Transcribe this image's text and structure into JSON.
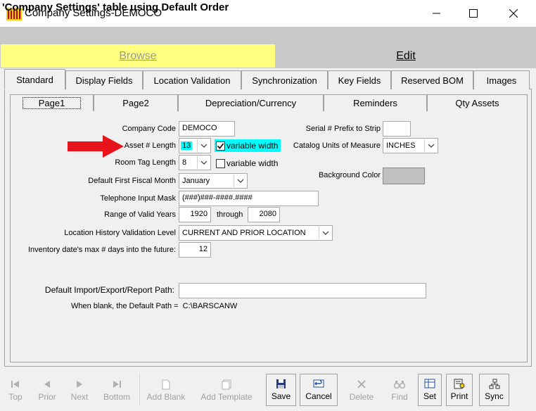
{
  "window": {
    "title": "Company Settings-DEMOCO",
    "header": "'Company Settings' table using Default Order"
  },
  "mode_tabs": {
    "browse": "Browse",
    "edit": "Edit"
  },
  "tabs": [
    "Standard",
    "Display Fields",
    "Location Validation",
    "Synchronization",
    "Key Fields",
    "Reserved BOM",
    "Images"
  ],
  "subtabs": [
    "Page1",
    "Page2",
    "Depreciation/Currency",
    "Reminders",
    "Qty Assets"
  ],
  "form": {
    "company_code": {
      "label": "Company Code",
      "value": "DEMOCO"
    },
    "asset_length": {
      "label": "Asset # Length",
      "value": "13",
      "checkbox_label": "variable width",
      "checked": true
    },
    "room_tag_length": {
      "label": "Room Tag Length",
      "value": "8",
      "checkbox_label": "variable width",
      "checked": false
    },
    "fiscal_month": {
      "label": "Default First Fiscal Month",
      "value": "January"
    },
    "phone_mask": {
      "label": "Telephone Input Mask",
      "value": "(###)###-####.####"
    },
    "valid_years": {
      "label": "Range of Valid Years",
      "from": "1920",
      "through_label": "through",
      "to": "2080"
    },
    "location_history": {
      "label": "Location History Validation Level",
      "value": "CURRENT AND PRIOR LOCATION"
    },
    "inventory_days": {
      "label": "Inventory date's max # days into the future:",
      "value": "12"
    },
    "serial_prefix": {
      "label": "Serial # Prefix to Strip",
      "value": ""
    },
    "catalog_units": {
      "label": "Catalog Units of Measure",
      "value": "INCHES"
    },
    "background_color": {
      "label": "Background Color",
      "value": "#c0c0c0"
    },
    "default_path": {
      "label": "Default Import/Export/Report Path:",
      "value": "",
      "note": "When blank, the Default Path =  C:\\BARSCANW"
    }
  },
  "toolbar": {
    "top": "Top",
    "prior": "Prior",
    "next": "Next",
    "bottom": "Bottom",
    "add_blank": "Add Blank",
    "add_template": "Add Template",
    "save": "Save",
    "cancel": "Cancel",
    "delete": "Delete",
    "find": "Find",
    "set": "Set",
    "print": "Print",
    "sync": "Sync"
  },
  "colors": {
    "highlight": "#00ffff",
    "browse_bg": "#ffff80",
    "header_bg": "#c8c8c8",
    "arrow": "#e8141b"
  }
}
